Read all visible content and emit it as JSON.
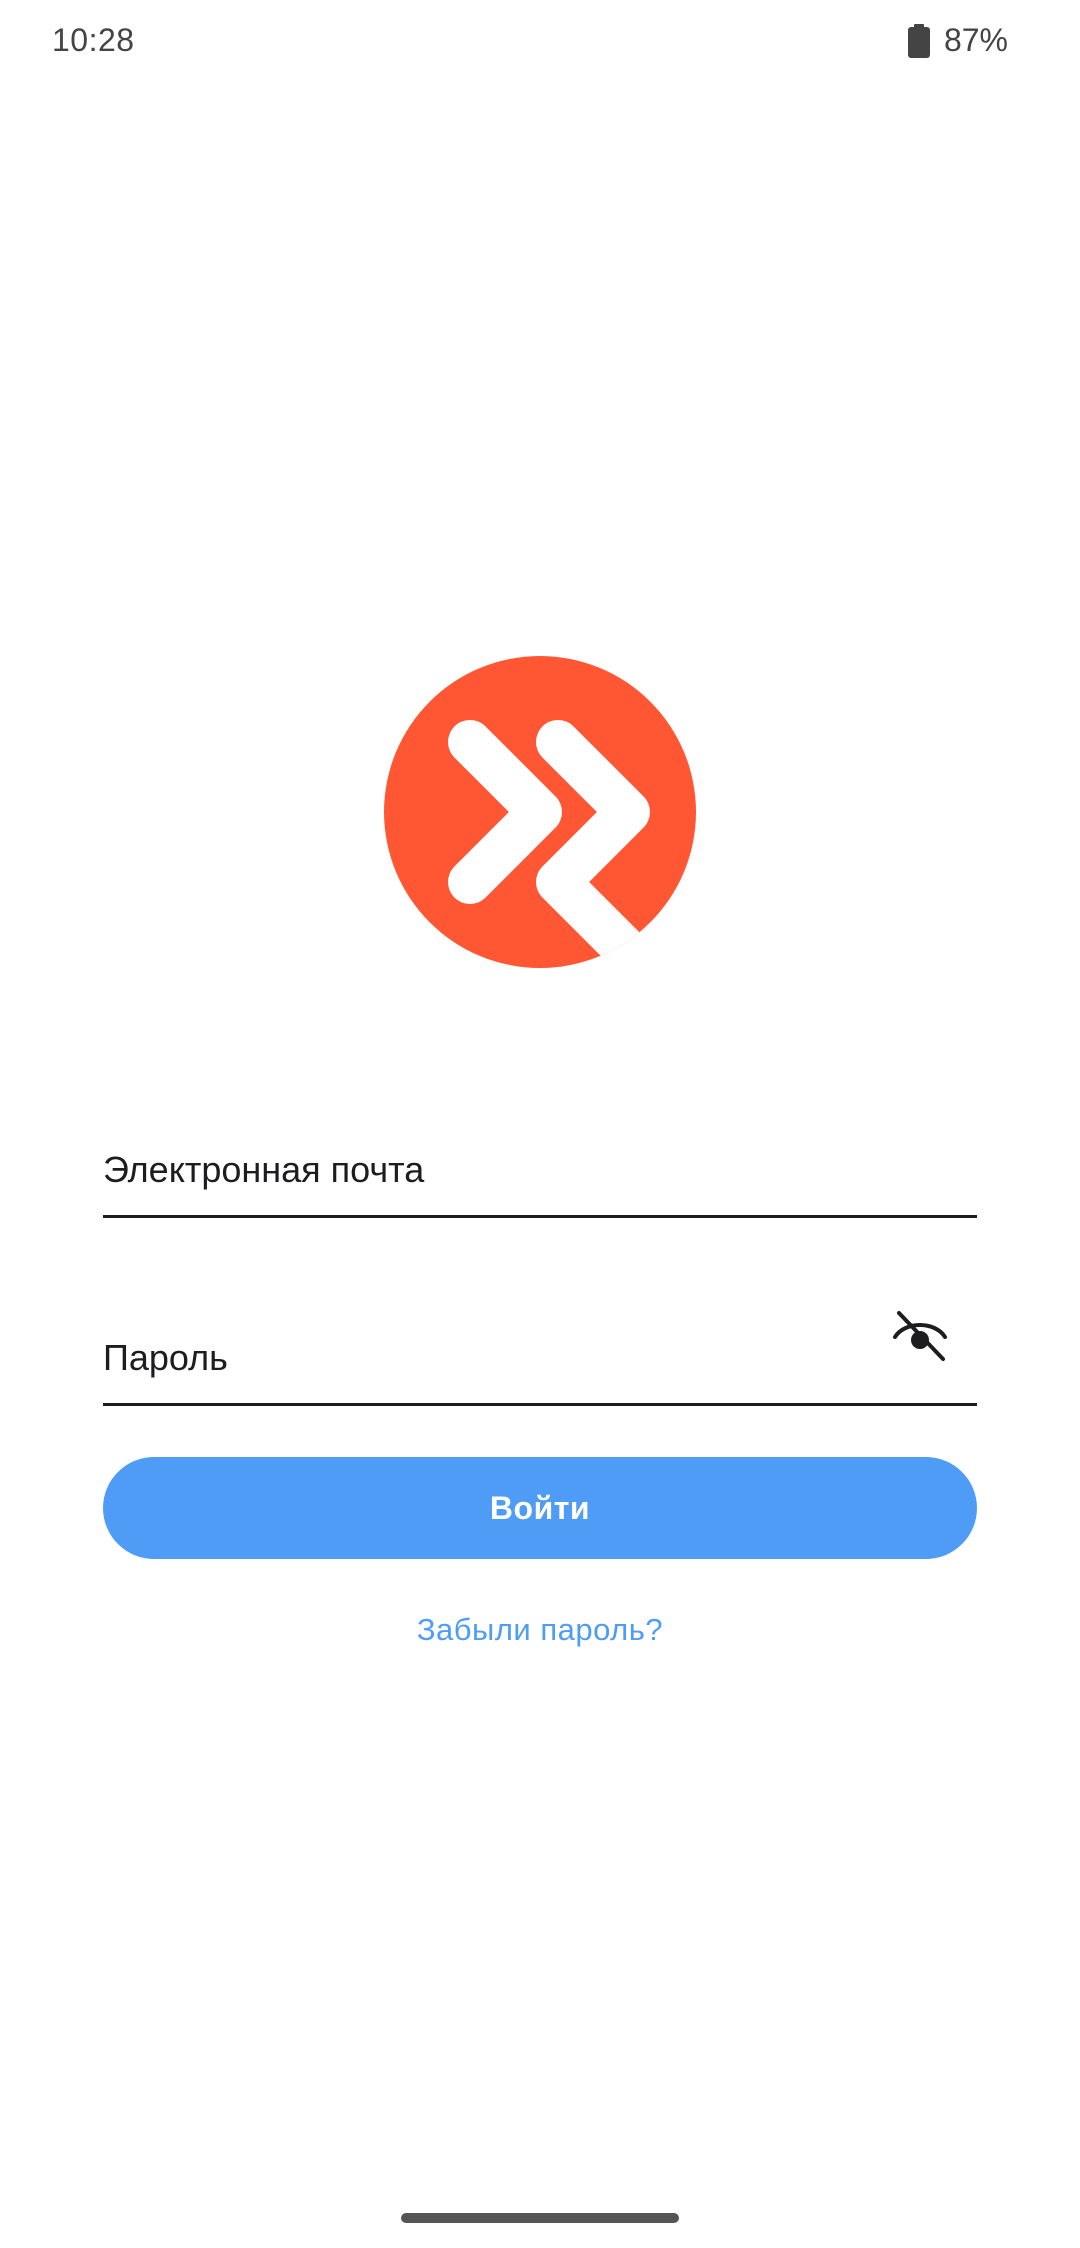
{
  "status_bar": {
    "time": "10:28",
    "battery_icon": "battery-icon",
    "battery_percent": "87%"
  },
  "logo": {
    "icon": "double-chevron-logo-icon",
    "color": "#ff5733"
  },
  "form": {
    "email": {
      "placeholder": "Электронная почта",
      "value": ""
    },
    "password": {
      "placeholder": "Пароль",
      "value": "",
      "toggle_icon": "eye-off-icon"
    },
    "login_label": "Войти",
    "login_color": "#4f9cf7",
    "forgot_label": "Забыли пароль?"
  }
}
